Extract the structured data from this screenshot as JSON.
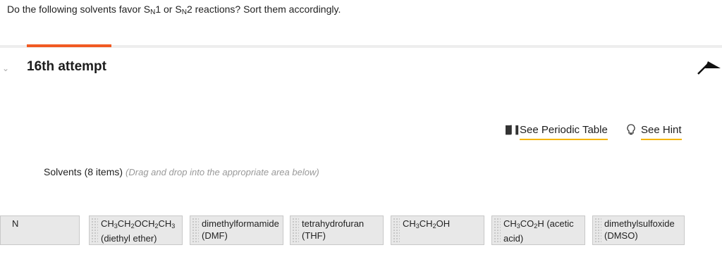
{
  "question": {
    "prefix": "Do the following solvents favor S",
    "sub1": "N",
    "mid": "1 or S",
    "sub2": "N",
    "suffix": "2 reactions? Sort them accordingly."
  },
  "attempt": {
    "title": "16th attempt"
  },
  "tools": {
    "periodic_table": "See Periodic Table",
    "hint": "See Hint"
  },
  "solvents": {
    "label": "Solvents (8 items)",
    "instructions": "(Drag and drop into the appropriate area below)"
  },
  "items": [
    {
      "text": "N"
    },
    {
      "text": "CH3CH2OCH2CH3 (diethyl ether)"
    },
    {
      "text": "dimethylformamide (DMF)"
    },
    {
      "text": "tetrahydrofuran (THF)"
    },
    {
      "text": "CH3CH2OH"
    },
    {
      "text": "CH3CO2H (acetic acid)"
    },
    {
      "text": "dimethylsulfoxide (DMSO)"
    }
  ],
  "icons": {
    "periodic": "bar-chart-icon",
    "hint": "lightbulb-icon",
    "collapse": "arrow-up-icon",
    "expand": "chevron-down-icon"
  },
  "colors": {
    "accent": "#f15a22",
    "link_underline": "#f4b400",
    "tile": "#e8e8e8"
  }
}
